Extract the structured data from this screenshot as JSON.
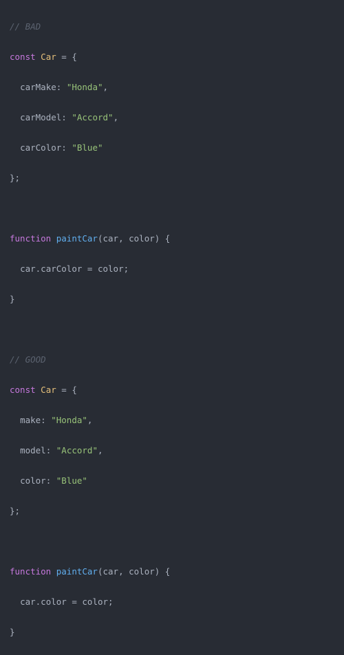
{
  "bad": {
    "comment": "// BAD",
    "kw_const": "const",
    "var_name": "Car",
    "eq_open": " = {",
    "p1_key": "carMake",
    "p1_val": "\"Honda\"",
    "p2_key": "carModel",
    "p2_val": "\"Accord\"",
    "p3_key": "carColor",
    "p3_val": "\"Blue\"",
    "close": "};",
    "fn_kw": "function",
    "fn_name": "paintCar",
    "fn_params": "(car, color) {",
    "body_l": "car",
    "body_dot": ".",
    "body_prop": "carColor",
    "body_r": " = color;",
    "fn_close": "}"
  },
  "good": {
    "comment": "// GOOD",
    "kw_const": "const",
    "var_name": "Car",
    "eq_open": " = {",
    "p1_key": "make",
    "p1_val": "\"Honda\"",
    "p2_key": "model",
    "p2_val": "\"Accord\"",
    "p3_key": "color",
    "p3_val": "\"Blue\"",
    "close": "};",
    "fn_kw": "function",
    "fn_name": "paintCar",
    "fn_params": "(car, color) {",
    "body_l": "car",
    "body_dot": ".",
    "body_prop": "color",
    "body_r": " = color;",
    "fn_close": "}"
  }
}
